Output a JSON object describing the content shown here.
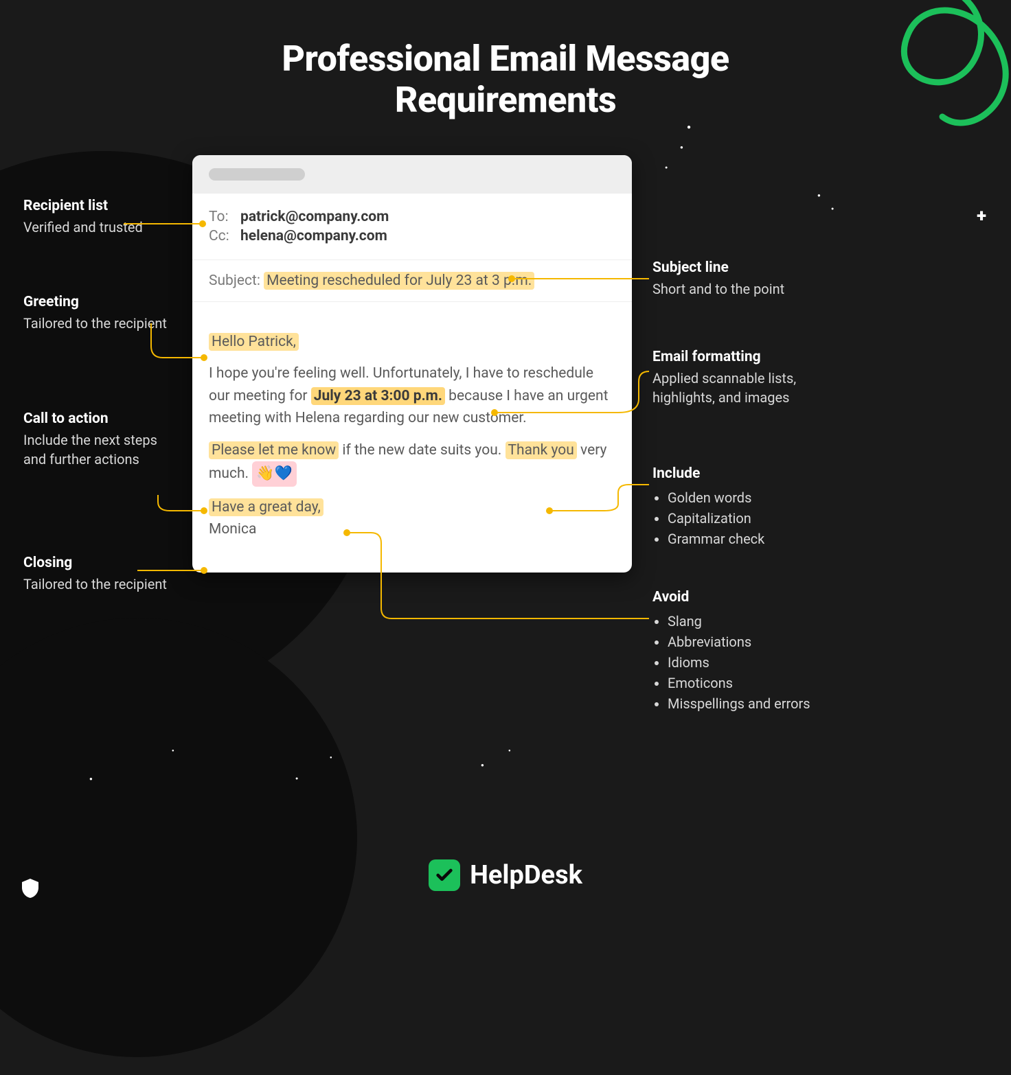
{
  "title_line1": "Professional Email Message",
  "title_line2": "Requirements",
  "email": {
    "to_label": "To:",
    "to": "patrick@company.com",
    "cc_label": "Cc:",
    "cc": "helena@company.com",
    "subject_label": "Subject:",
    "subject_hl": "Meeting rescheduled for July 23 at 3 p.m.",
    "greeting": "Hello Patrick,",
    "body1_a": "I hope you're feeling well. Unfortunately, I have to reschedule our meeting for ",
    "body1_hl": "July 23 at 3:00 p.m.",
    "body1_b": " because I have an urgent meeting with Helena regarding our new customer.",
    "cta_hl": "Please let me know",
    "cta_mid": " if the new date suits you. ",
    "thanks_hl": "Thank you",
    "cta_tail": " very much. ",
    "emoji": "👋💙",
    "close_hl": "Have a great day,",
    "signature": "Monica"
  },
  "left": {
    "recipient_t": "Recipient list",
    "recipient_d": "Verified and trusted",
    "greeting_t": "Greeting",
    "greeting_d": "Tailored to the recipient",
    "cta_t": "Call to action",
    "cta_d": "Include the next steps and further actions",
    "closing_t": "Closing",
    "closing_d": "Tailored to the recipient"
  },
  "right": {
    "subject_t": "Subject line",
    "subject_d": "Short and to the point",
    "fmt_t": "Email formatting",
    "fmt_d": "Applied scannable lists, highlights, and images",
    "include_t": "Include",
    "include_items": [
      "Golden words",
      "Capitalization",
      "Grammar check"
    ],
    "avoid_t": "Avoid",
    "avoid_items": [
      "Slang",
      "Abbreviations",
      "Idioms",
      "Emoticons",
      "Misspellings and errors"
    ]
  },
  "footer": "HelpDesk"
}
